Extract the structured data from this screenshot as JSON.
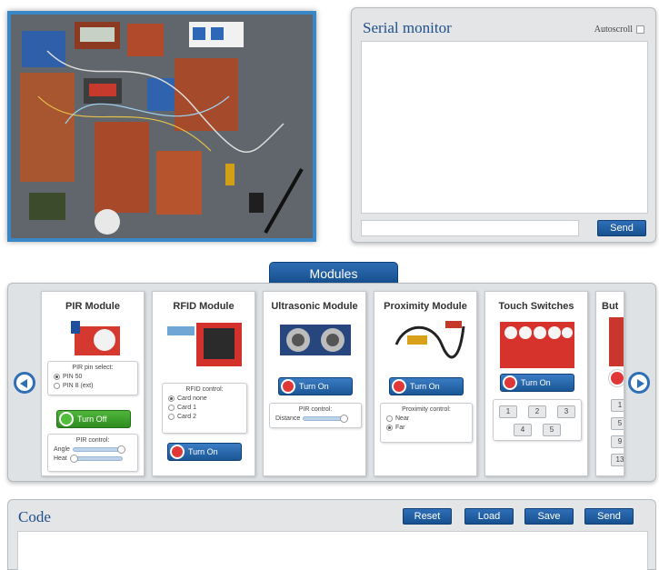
{
  "serial_monitor": {
    "title": "Serial monitor",
    "autoscroll_label": "Autoscroll",
    "send_label": "Send"
  },
  "modules": {
    "tab_label": "Modules",
    "cards": {
      "pir": {
        "title": "PIR Module",
        "pin_select_title": "PIR pin select:",
        "pin_options": [
          "PIN 50",
          "PIN 8 (ext)"
        ],
        "toggle_label": "Turn Off",
        "control_title": "PIR control:",
        "sliders": [
          "Angle",
          "Heat"
        ]
      },
      "rfid": {
        "title": "RFID Module",
        "control_title": "RFID control:",
        "card_options": [
          "Card none",
          "Card 1",
          "Card 2"
        ],
        "toggle_label": "Turn On"
      },
      "ultrasonic": {
        "title": "Ultrasonic Module",
        "toggle_label": "Turn On",
        "control_title": "PIR control:",
        "slider_label": "Distance"
      },
      "proximity": {
        "title": "Proximity Module",
        "toggle_label": "Turn On",
        "control_title": "Proximity control:",
        "options": [
          "Near",
          "Far"
        ]
      },
      "touch": {
        "title": "Touch Switches",
        "toggle_label": "Turn On",
        "keys": [
          "1",
          "2",
          "3",
          "4",
          "5"
        ]
      },
      "buttons": {
        "title": "But",
        "keys": [
          "1",
          "5",
          "9",
          "13"
        ]
      }
    }
  },
  "code": {
    "title": "Code",
    "reset_label": "Reset",
    "load_label": "Load",
    "save_label": "Save",
    "send_label": "Send"
  },
  "colors": {
    "accent": "#1f5fa8",
    "panel_bg": "#e3e5e7",
    "toggle_on": "#4fbf3b",
    "toggle_off": "#e03838"
  },
  "icons": {
    "carousel_prev": "chevron-left-circle-icon",
    "carousel_next": "chevron-right-circle-icon"
  }
}
